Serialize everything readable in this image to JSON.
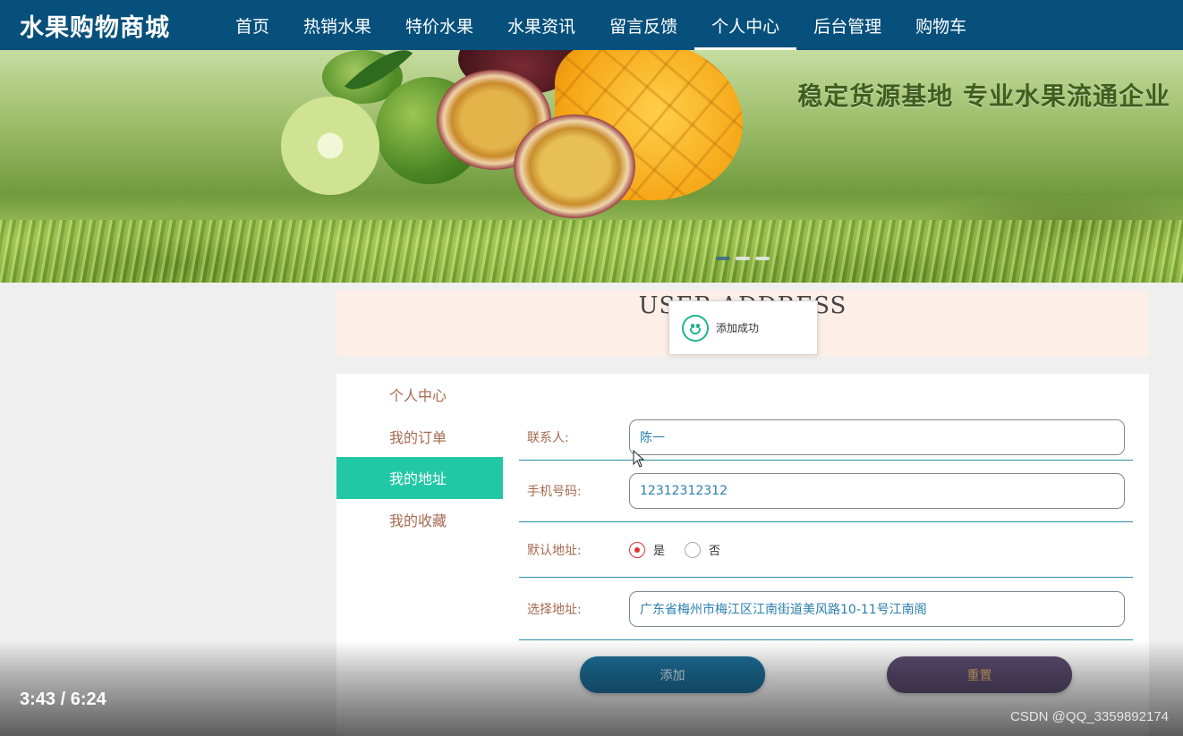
{
  "nav": {
    "logo": "水果购物商城",
    "items": [
      {
        "label": "首页",
        "active": false
      },
      {
        "label": "热销水果",
        "active": false
      },
      {
        "label": "特价水果",
        "active": false
      },
      {
        "label": "水果资讯",
        "active": false
      },
      {
        "label": "留言反馈",
        "active": false
      },
      {
        "label": "个人中心",
        "active": true
      },
      {
        "label": "后台管理",
        "active": false
      },
      {
        "label": "购物车",
        "active": false
      }
    ]
  },
  "banner": {
    "slogan": "稳定货源基地 专业水果流通企业",
    "slide_count": 3,
    "active_slide": 1
  },
  "section": {
    "title": "USER ADDRESS"
  },
  "toast": {
    "message": "添加成功",
    "icon": "smile-icon"
  },
  "side_menu": {
    "items": [
      {
        "label": "个人中心",
        "active": false
      },
      {
        "label": "我的订单",
        "active": false
      },
      {
        "label": "我的地址",
        "active": true
      },
      {
        "label": "我的收藏",
        "active": false
      }
    ]
  },
  "form": {
    "contact": {
      "label": "联系人:",
      "value": "陈一"
    },
    "phone": {
      "label": "手机号码:",
      "value": "12312312312"
    },
    "default_address": {
      "label": "默认地址:",
      "options": [
        {
          "label": "是",
          "checked": true
        },
        {
          "label": "否",
          "checked": false
        }
      ]
    },
    "address": {
      "label": "选择地址:",
      "value": "广东省梅州市梅江区江南街道美风路10-11号江南阁"
    },
    "add_button": "添加",
    "reset_button": "重置"
  },
  "video": {
    "time": "3:43 / 6:24"
  },
  "watermark": "CSDN @QQ_3359892174",
  "colors": {
    "nav_bg": "#07507c",
    "side_active": "#22c8a5",
    "label_text": "#a66a4f",
    "add_button": "#1d6f9a",
    "reset_button": "#5c4d72",
    "title_box_bg": "#fdeee7"
  }
}
